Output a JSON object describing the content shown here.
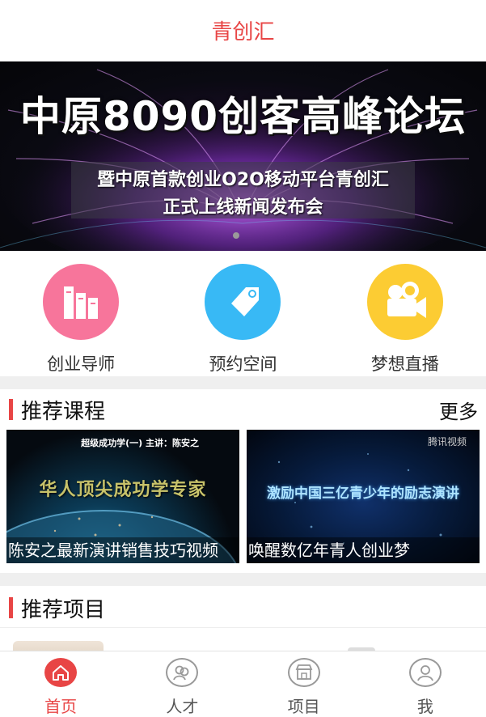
{
  "header": {
    "title": "青创汇",
    "title_color": "#e84545"
  },
  "banner": {
    "title": "中原8090创客高峰论坛",
    "subtitle_line1": "暨中原首款创业O2O移动平台青创汇",
    "subtitle_line2": "正式上线新闻发布会",
    "active_dot": 1,
    "dot_count": 1
  },
  "quick_nav": [
    {
      "label": "创业导师",
      "icon": "books-icon",
      "color": "#f7759b"
    },
    {
      "label": "预约空间",
      "icon": "tag-icon",
      "color": "#38b9f5"
    },
    {
      "label": "梦想直播",
      "icon": "video-camera-icon",
      "color": "#fccc33"
    }
  ],
  "courses_section": {
    "title": "推荐课程",
    "more_label": "更多",
    "items": [
      {
        "caption": "陈安之最新演讲销售技巧视频",
        "thumb_header": "超级成功学(一) 主讲：陈安之",
        "thumb_text": "华人顶尖成功学专家"
      },
      {
        "caption": "唤醒数亿年青人创业梦",
        "thumb_header": "腾讯视频",
        "thumb_text": "激励中国三亿青少年的励志演讲"
      }
    ]
  },
  "projects_section": {
    "title": "推荐项目"
  },
  "tabbar": {
    "active_color": "#e84545",
    "tabs": [
      {
        "label": "首页",
        "icon": "home-icon",
        "active": true
      },
      {
        "label": "人才",
        "icon": "people-icon",
        "active": false
      },
      {
        "label": "项目",
        "icon": "shop-icon",
        "active": false
      },
      {
        "label": "我",
        "icon": "user-icon",
        "active": false
      }
    ]
  }
}
